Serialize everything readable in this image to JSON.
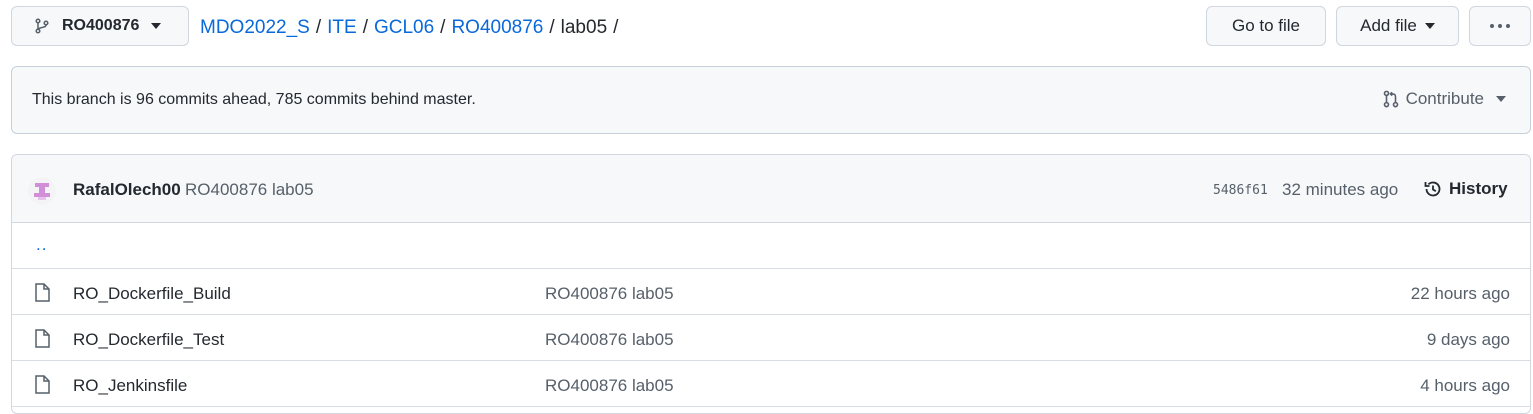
{
  "branch": {
    "name": "RO400876",
    "icon": "git-branch-icon"
  },
  "breadcrumb": {
    "items": [
      "MDO2022_S",
      "ITE",
      "GCL06",
      "RO400876"
    ],
    "current": "lab05",
    "separator": "/"
  },
  "toolbar": {
    "goto_label": "Go to file",
    "add_label": "Add file",
    "more_label": "···"
  },
  "flash": {
    "message": "This branch is 96 commits ahead, 785 commits behind master.",
    "contribute_label": "Contribute"
  },
  "commit": {
    "author": "RafalOlech00",
    "message": "RO400876 lab05",
    "sha": "5486f61",
    "time": "32 minutes ago",
    "history_label": "History"
  },
  "parent_link": "..",
  "files": [
    {
      "name": "RO_Dockerfile_Build",
      "commit": "RO400876 lab05",
      "age": "22 hours ago",
      "icon": "file-icon"
    },
    {
      "name": "RO_Dockerfile_Test",
      "commit": "RO400876 lab05",
      "age": "9 days ago",
      "icon": "file-icon"
    },
    {
      "name": "RO_Jenkinsfile",
      "commit": "RO400876 lab05",
      "age": "4 hours ago",
      "icon": "file-icon"
    }
  ],
  "colors": {
    "link": "#0969da",
    "muted": "#57606a",
    "text": "#24292f",
    "avatar": "#d28fd9"
  }
}
